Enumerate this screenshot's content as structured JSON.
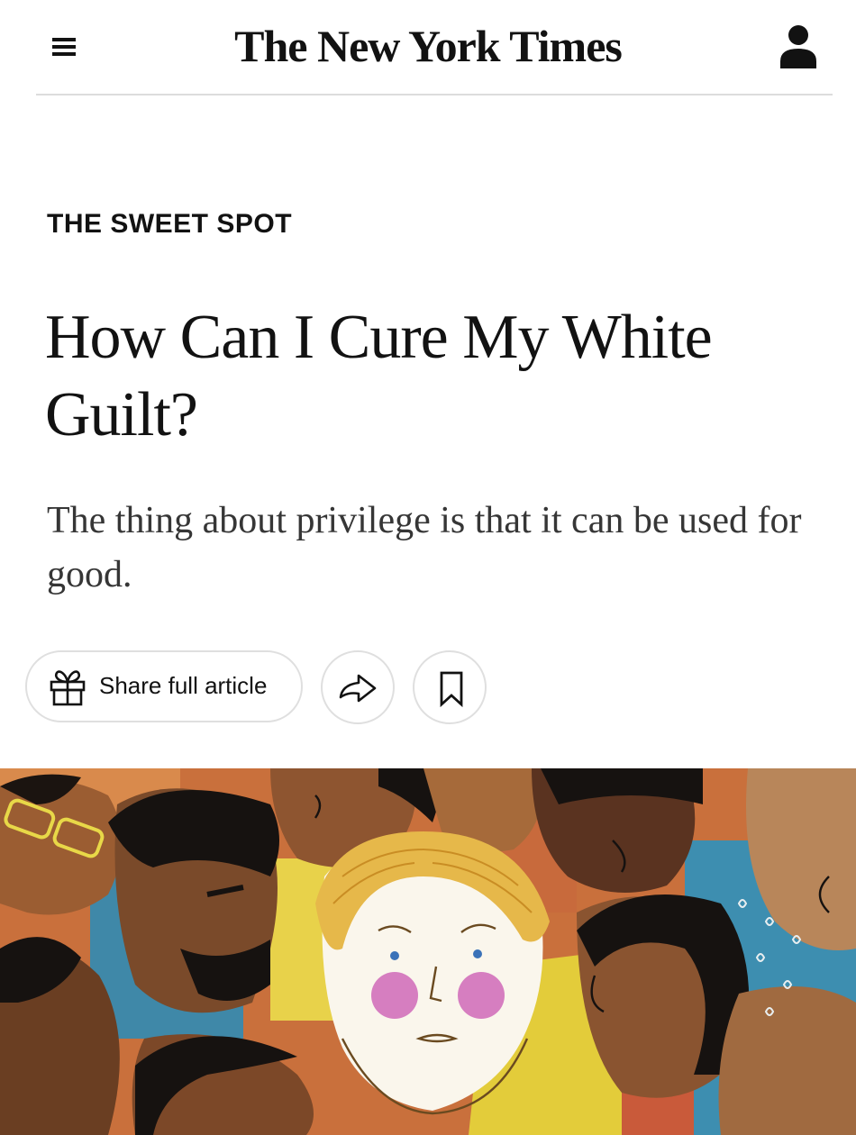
{
  "header": {
    "masthead": "The New York Times",
    "menu_icon": "hamburger-menu-icon",
    "account_icon": "user-account-icon"
  },
  "article": {
    "kicker": "THE SWEET SPOT",
    "headline": "How Can I Cure My White Guilt?",
    "summary": "The thing about privilege is that it can be used for good."
  },
  "actions": {
    "share_label": "Share full article",
    "share_icon": "gift-icon",
    "forward_icon": "share-arrow-icon",
    "save_icon": "bookmark-icon"
  },
  "colors": {
    "text": "#121212",
    "summary_text": "#363636",
    "border": "#dfdfdf"
  }
}
